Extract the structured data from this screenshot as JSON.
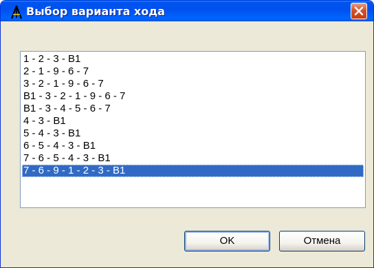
{
  "window": {
    "title": "Выбор варианта хода",
    "close_label": "×"
  },
  "moves": {
    "items": [
      "1 - 2 - 3 - B1",
      "2 - 1 - 9 - 6 - 7",
      "3 - 2 - 1 - 9 - 6 - 7",
      "B1 - 3 - 2 - 1 - 9 - 6 - 7",
      "B1 - 3 - 4 - 5 - 6 - 7",
      "4 - 3 - B1",
      "5 - 4 - 3 - B1",
      "6 - 5 - 4 - 3 - B1",
      "7 - 6 - 5 - 4 - 3 - B1",
      "7 - 6 - 9 - 1 - 2 - 3 - B1"
    ],
    "selected_index": 9
  },
  "buttons": {
    "ok_label": "OK",
    "cancel_label": "Отмена"
  },
  "colors": {
    "titlebar": "#0054e3",
    "selection": "#316ac5",
    "close": "#d3532a",
    "dialog_bg": "#ece9d8"
  },
  "icons": {
    "app": "compass-tool-icon",
    "close": "close-icon"
  }
}
